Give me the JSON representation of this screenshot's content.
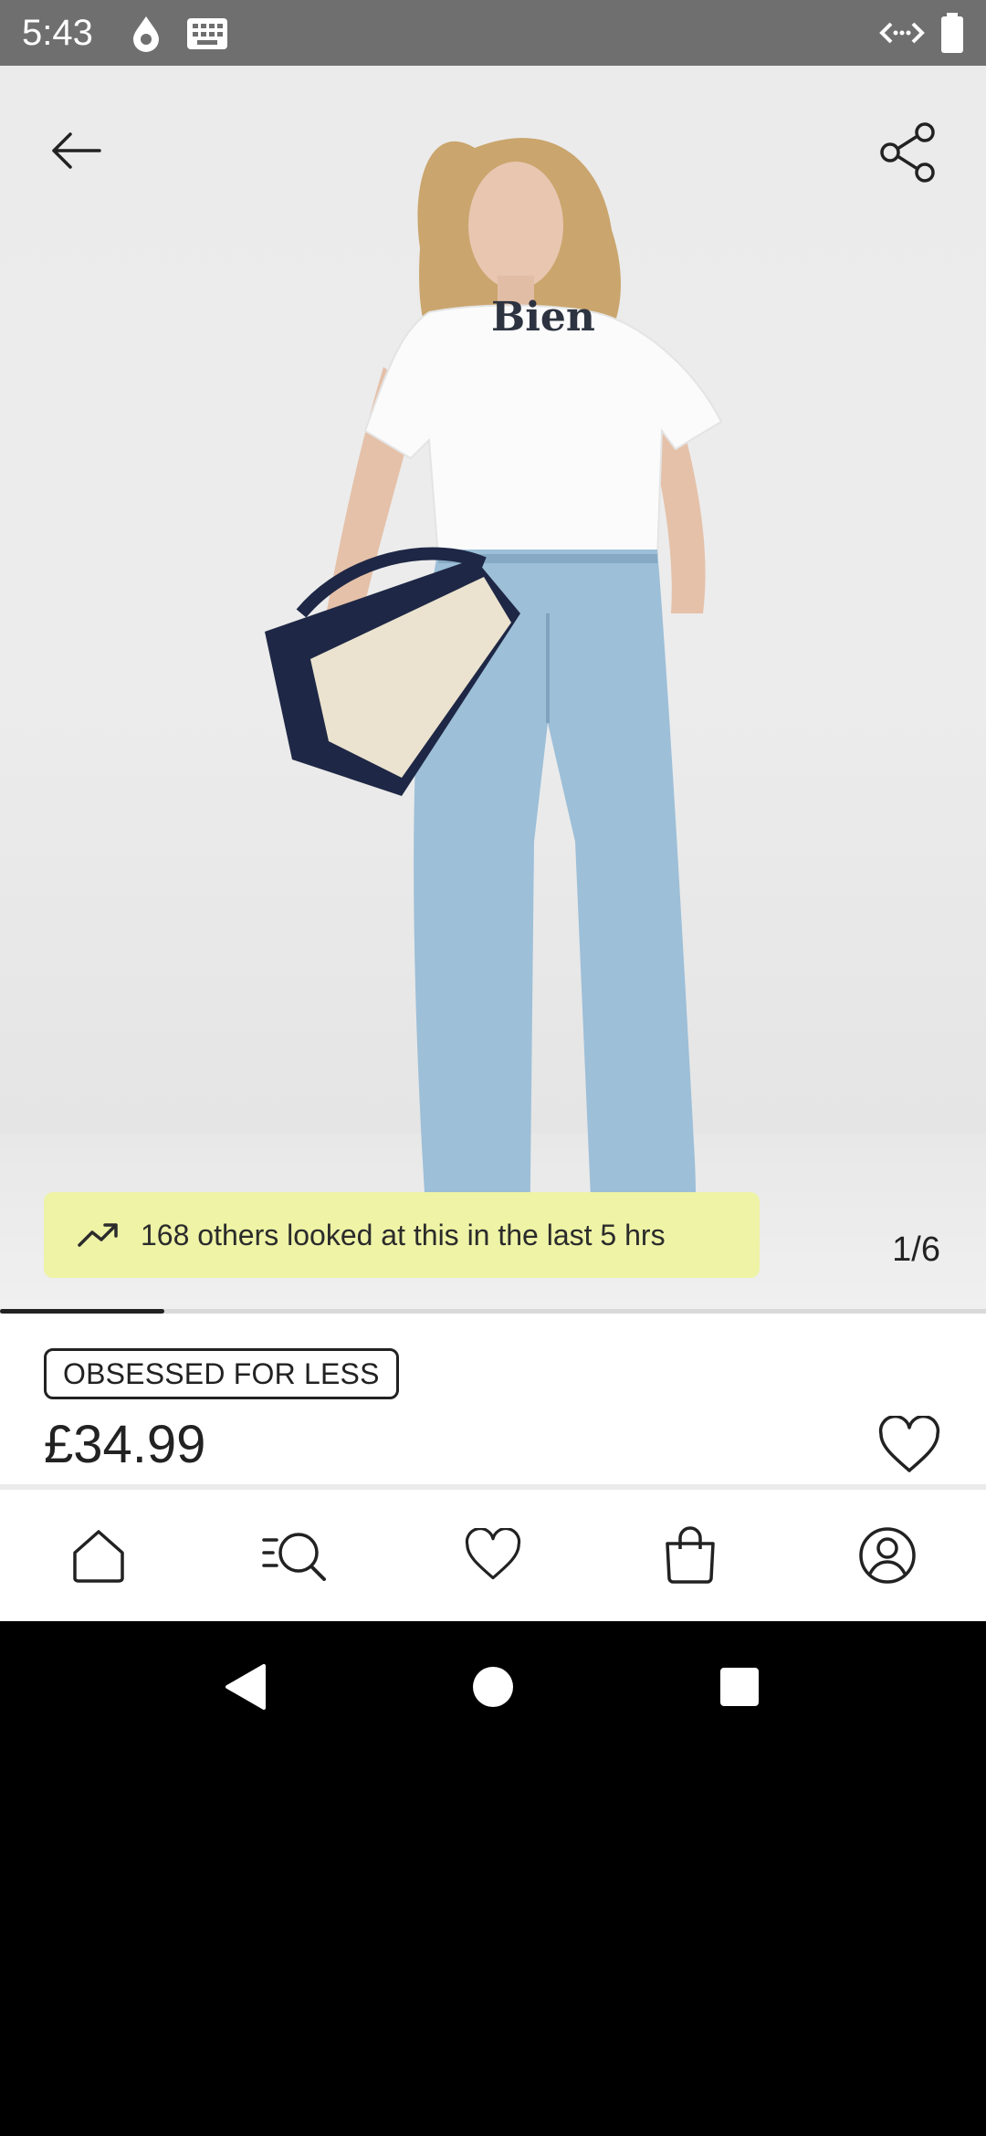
{
  "status_bar": {
    "time": "5:43",
    "icons": [
      "drop-icon",
      "keyboard-icon",
      "code-icon",
      "battery-icon"
    ]
  },
  "product": {
    "image": {
      "shirt_text": "Bien",
      "counter": "1/6",
      "progress_fraction": 0.1667
    },
    "trend_banner": {
      "icon": "trending-up-icon",
      "text": "168 others looked at this in the last 5 hrs"
    },
    "badge": "OBSESSED FOR LESS",
    "price": "£34.99"
  },
  "top_actions": {
    "back_icon": "back-arrow-icon",
    "share_icon": "share-icon"
  },
  "bottom_nav": {
    "items": [
      "home-icon",
      "search-icon",
      "wishlist-icon",
      "bag-icon",
      "account-icon"
    ]
  },
  "colors": {
    "banner_bg": "#eef3a6",
    "status_bar": "#6f6f6f",
    "text": "#222222"
  }
}
